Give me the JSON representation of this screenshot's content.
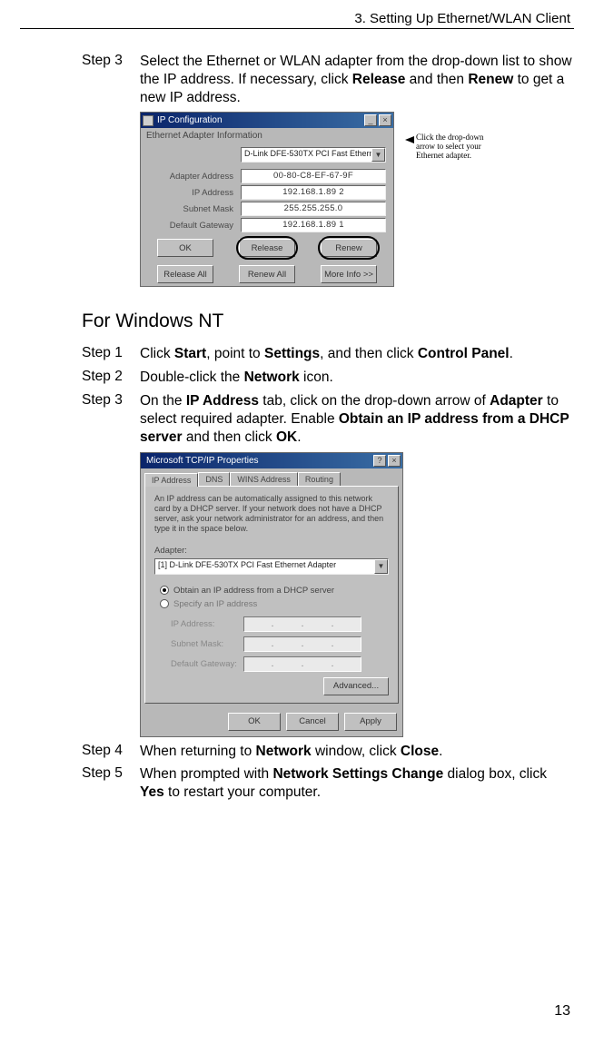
{
  "runhead": "3. Setting Up Ethernet/WLAN Client",
  "top": {
    "step3": {
      "label": "Step 3",
      "t1": "Select the Ethernet or WLAN adapter from the drop-down list to show the IP address. If necessary, click ",
      "b1": "Release",
      "t2": " and then ",
      "b2": "Renew",
      "t3": " to get a new IP address."
    }
  },
  "callout": {
    "line1": "Click the drop-down",
    "line2": "arrow to select your",
    "line3": "Ethernet adapter."
  },
  "ipc": {
    "title": "IP Configuration",
    "group": "Ethernet Adapter Information",
    "adapter": "D-Link DFE-530TX PCI Fast Etherne",
    "rows": {
      "mac": {
        "label": "Adapter Address",
        "val": "00-80-C8-EF-67-9F"
      },
      "ip": {
        "label": "IP Address",
        "val": "192.168.1.89 2"
      },
      "mask": {
        "label": "Subnet Mask",
        "val": "255.255.255.0"
      },
      "gw": {
        "label": "Default Gateway",
        "val": "192.168.1.89 1"
      }
    },
    "btns": {
      "ok": "OK",
      "release": "Release",
      "renew": "Renew",
      "releaseAll": "Release All",
      "renewAll": "Renew All",
      "more": "More Info >>"
    },
    "winbtns": {
      "min": "_",
      "close": "×"
    }
  },
  "section": "For Windows NT",
  "nt": {
    "step1": {
      "label": "Step 1",
      "t1": "Click ",
      "b1": "Start",
      "t2": ", point to ",
      "b2": "Settings",
      "t3": ", and then click ",
      "b3": "Control Panel",
      "t4": "."
    },
    "step2": {
      "label": "Step 2",
      "t1": "Double-click the ",
      "b1": "Network",
      "t2": " icon."
    },
    "step3": {
      "label": "Step 3",
      "t1": "On the ",
      "b1": "IP Address",
      "t2": " tab, click on the drop-down arrow of ",
      "b2": "Adapter",
      "t3": " to select required adapter. Enable ",
      "b3": "Obtain an IP address from a DHCP server",
      "t4": " and then click ",
      "b4": "OK",
      "t5": "."
    },
    "step4": {
      "label": "Step 4",
      "t1": "When returning to ",
      "b1": "Network",
      "t2": " window, click ",
      "b2": "Close",
      "t3": "."
    },
    "step5": {
      "label": "Step 5",
      "t1": "When prompted with ",
      "b1": "Network Settings Change",
      "t2": " dialog box, click ",
      "b2": "Yes",
      "t3": " to restart your computer."
    }
  },
  "tcp": {
    "title": "Microsoft TCP/IP Properties",
    "winbtns": {
      "help": "?",
      "close": "×"
    },
    "tabs": {
      "ip": "IP Address",
      "dns": "DNS",
      "wins": "WINS Address",
      "routing": "Routing"
    },
    "desc": "An IP address can be automatically assigned to this network card by a DHCP server. If your network does not have a DHCP server, ask your network administrator for an address, and then type it in the space below.",
    "adapterLabel": "Adapter:",
    "adapter": "[1] D-Link DFE-530TX PCI Fast Ethernet Adapter",
    "r1": "Obtain an IP address from a DHCP server",
    "r2": "Specify an IP address",
    "ipLabel": "IP Address:",
    "maskLabel": "Subnet Mask:",
    "gwLabel": "Default Gateway:",
    "advanced": "Advanced...",
    "ok": "OK",
    "cancel": "Cancel",
    "apply": "Apply"
  },
  "pageNumber": "13"
}
